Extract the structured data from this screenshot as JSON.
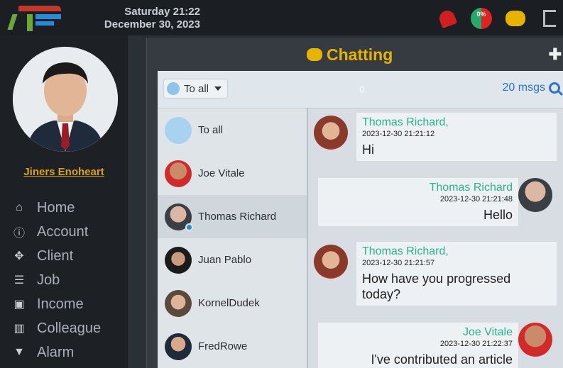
{
  "header": {
    "day_time": "Saturday 21:22",
    "date": "December 30, 2023",
    "badge_percent": "0%"
  },
  "user": {
    "name": "Jiners Enoheart"
  },
  "nav": [
    {
      "label": "Home",
      "icon": "home-icon"
    },
    {
      "label": "Account",
      "icon": "info-icon"
    },
    {
      "label": "Client",
      "icon": "crosshair-icon"
    },
    {
      "label": "Job",
      "icon": "list-icon"
    },
    {
      "label": "Income",
      "icon": "money-icon"
    },
    {
      "label": "Colleague",
      "icon": "colleague-icon"
    },
    {
      "label": "Alarm",
      "icon": "megaphone-icon"
    }
  ],
  "chat": {
    "title": "Chatting",
    "recipient": "To all",
    "count": "0",
    "msgs_label": "20 msgs",
    "contacts": [
      {
        "name": "To all"
      },
      {
        "name": "Joe Vitale"
      },
      {
        "name": "Thomas Richard"
      },
      {
        "name": "Juan Pablo"
      },
      {
        "name": "KornelDudek"
      },
      {
        "name": "FredRowe"
      }
    ],
    "messages": [
      {
        "sender": "Thomas Richard,",
        "time": "2023-12-30 21:21:12",
        "text": "Hi"
      },
      {
        "sender": "Thomas Richard",
        "time": "2023-12-30 21:21:48",
        "text": "Hello"
      },
      {
        "sender": "Thomas Richard,",
        "time": "2023-12-30 21:21:57",
        "text": "How have you progressed today?"
      },
      {
        "sender": "Joe Vitale",
        "time": "2023-12-30 21:22:37",
        "text": "I've contributed an article"
      }
    ]
  },
  "colors": {
    "accent_gold": "#e6b400",
    "sender_green": "#2ab38a",
    "link_blue": "#2a75c9"
  }
}
